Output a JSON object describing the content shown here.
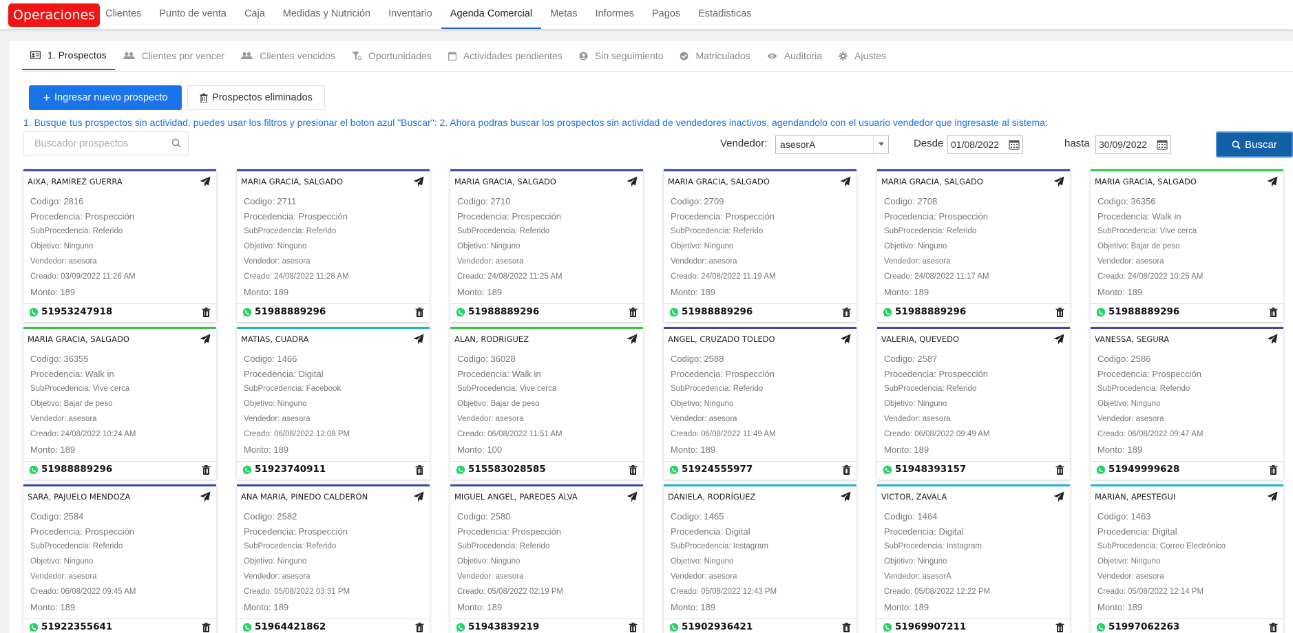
{
  "brand": "Operaciones",
  "topnav": [
    "Clientes",
    "Punto de venta",
    "Caja",
    "Medidas y Nutrición",
    "Inventario",
    "Agenda Comercial",
    "Metas",
    "Informes",
    "Pagos",
    "Estadisticas"
  ],
  "topnav_active": "Agenda Comercial",
  "tabs": [
    {
      "label": "1. Prospectos",
      "icon": "id-card-icon",
      "active": true
    },
    {
      "label": "Clientes por vencer",
      "icon": "users-icon"
    },
    {
      "label": "Clientes vencidos",
      "icon": "users-icon"
    },
    {
      "label": "Oportunidades",
      "icon": "filter-icon"
    },
    {
      "label": "Actividades pendientes",
      "icon": "calendar-icon"
    },
    {
      "label": "Sin seguimiento",
      "icon": "user-circle-icon"
    },
    {
      "label": "Matriculados",
      "icon": "check-circle-icon"
    },
    {
      "label": "Auditoria",
      "icon": "eye-icon"
    },
    {
      "label": "Ajustes",
      "icon": "gear-icon"
    }
  ],
  "actions": {
    "new_prospect": "Ingresar nuevo prospecto",
    "deleted_prospects": "Prospectos eliminados"
  },
  "help_text": "1. Busque tus prospectos sin actividad, puedes usar los filtros y presionar el boton azul \"Buscar\": 2. Ahora podras buscar los prospectos sin actividad de vendedores inactivos, agendandolo con el usuario vendedor que ingresaste al sistema:",
  "filters": {
    "search_placeholder": "Buscador prospectos",
    "vendedor_label": "Vendedor:",
    "vendedor_value": "asesorA",
    "desde_label": "Desde",
    "desde_value": "01/08/2022",
    "hasta_label": "hasta",
    "hasta_value": "30/09/2022",
    "buscar_label": "Buscar"
  },
  "colors": {
    "brand": "#f01414",
    "primary": "#1a73e8",
    "buscar": "#1460a6",
    "card_blue": "#3a4aa8",
    "card_green": "#2ecc40",
    "card_cyan": "#1ab5d0",
    "whatsapp": "#25d366"
  },
  "prospects": [
    {
      "name": "AIXA, RAMÍREZ GUERRA",
      "codigo": "Codigo: 2816",
      "procedencia": "Procedencia: Prospección",
      "subprocedencia": "SubProcedencia: Referido",
      "objetivo": "Objetivo: Ninguno",
      "vendedor": "Vendedor: asesora",
      "creado": "Creado: 03/09/2022 11:26 AM",
      "monto": "Monto: 189",
      "phone": "51953247918",
      "accent": "blue"
    },
    {
      "name": "MARIA GRACIA, SALGADO",
      "codigo": "Codigo: 2711",
      "procedencia": "Procedencia: Prospección",
      "subprocedencia": "SubProcedencia: Referido",
      "objetivo": "Objetivo: Ninguno",
      "vendedor": "Vendedor: asesora",
      "creado": "Creado: 24/08/2022 11:28 AM",
      "monto": "Monto: 189",
      "phone": "51988889296",
      "accent": "blue"
    },
    {
      "name": "MARIA GRACIA, SALGADO",
      "codigo": "Codigo: 2710",
      "procedencia": "Procedencia: Prospección",
      "subprocedencia": "SubProcedencia: Referido",
      "objetivo": "Objetivo: Ninguno",
      "vendedor": "Vendedor: asesora",
      "creado": "Creado: 24/08/2022 11:25 AM",
      "monto": "Monto: 189",
      "phone": "51988889296",
      "accent": "blue"
    },
    {
      "name": "MARIA GRACIA, SALGADO",
      "codigo": "Codigo: 2709",
      "procedencia": "Procedencia: Prospección",
      "subprocedencia": "SubProcedencia: Referido",
      "objetivo": "Objetivo: Ninguno",
      "vendedor": "Vendedor: asesora",
      "creado": "Creado: 24/08/2022 11:19 AM",
      "monto": "Monto: 189",
      "phone": "51988889296",
      "accent": "blue"
    },
    {
      "name": "MARIA GRACIA, SALGADO",
      "codigo": "Codigo: 2708",
      "procedencia": "Procedencia: Prospección",
      "subprocedencia": "SubProcedencia: Referido",
      "objetivo": "Objetivo: Ninguno",
      "vendedor": "Vendedor: asesora",
      "creado": "Creado: 24/08/2022 11:17 AM",
      "monto": "Monto: 189",
      "phone": "51988889296",
      "accent": "blue"
    },
    {
      "name": "MARIA GRACIA, SALGADO",
      "codigo": "Codigo: 36356",
      "procedencia": "Procedencia: Walk in",
      "subprocedencia": "SubProcedencia: Vive cerca",
      "objetivo": "Objetivo: Bajar de peso",
      "vendedor": "Vendedor: asesora",
      "creado": "Creado: 24/08/2022 10:25 AM",
      "monto": "Monto: 189",
      "phone": "51988889296",
      "accent": "green"
    },
    {
      "name": "MARIA GRACIA, SALGADO",
      "codigo": "Codigo: 36355",
      "procedencia": "Procedencia: Walk in",
      "subprocedencia": "SubProcedencia: Vive cerca",
      "objetivo": "Objetivo: Bajar de peso",
      "vendedor": "Vendedor: asesora",
      "creado": "Creado: 24/08/2022 10:24 AM",
      "monto": "Monto: 189",
      "phone": "51988889296",
      "accent": "green"
    },
    {
      "name": "MATIAS, CUADRA",
      "codigo": "Codigo: 1466",
      "procedencia": "Procedencia: Digital",
      "subprocedencia": "SubProcedencia: Facebook",
      "objetivo": "Objetivo: Ninguno",
      "vendedor": "Vendedor: asesora",
      "creado": "Creado: 06/08/2022 12:08 PM",
      "monto": "Monto: 189",
      "phone": "51923740911",
      "accent": "cyan"
    },
    {
      "name": "ALAN, RODRIGUEZ",
      "codigo": "Codigo: 36028",
      "procedencia": "Procedencia: Walk in",
      "subprocedencia": "SubProcedencia: Vive cerca",
      "objetivo": "Objetivo: Bajar de peso",
      "vendedor": "Vendedor: asesora",
      "creado": "Creado: 06/08/2022 11:51 AM",
      "monto": "Monto: 100",
      "phone": "515583028585",
      "accent": "green"
    },
    {
      "name": "ANGEL, CRUZADO TOLEDO",
      "codigo": "Codigo: 2588",
      "procedencia": "Procedencia: Prospección",
      "subprocedencia": "SubProcedencia: Referido",
      "objetivo": "Objetivo: Ninguno",
      "vendedor": "Vendedor: asesora",
      "creado": "Creado: 06/08/2022 11:49 AM",
      "monto": "Monto: 189",
      "phone": "51924555977",
      "accent": "blue"
    },
    {
      "name": "VALERIA, QUEVEDO",
      "codigo": "Codigo: 2587",
      "procedencia": "Procedencia: Prospección",
      "subprocedencia": "SubProcedencia: Referido",
      "objetivo": "Objetivo: Ninguno",
      "vendedor": "Vendedor: asesora",
      "creado": "Creado: 06/08/2022 09:49 AM",
      "monto": "Monto: 189",
      "phone": "51948393157",
      "accent": "blue"
    },
    {
      "name": "VANESSA, SEGURA",
      "codigo": "Codigo: 2586",
      "procedencia": "Procedencia: Prospección",
      "subprocedencia": "SubProcedencia: Referido",
      "objetivo": "Objetivo: Ninguno",
      "vendedor": "Vendedor: asesora",
      "creado": "Creado: 06/08/2022 09:47 AM",
      "monto": "Monto: 189",
      "phone": "51949999628",
      "accent": "blue"
    },
    {
      "name": "SARA, PAJUELO MENDOZA",
      "codigo": "Codigo: 2584",
      "procedencia": "Procedencia: Prospección",
      "subprocedencia": "SubProcedencia: Referido",
      "objetivo": "Objetivo: Ninguno",
      "vendedor": "Vendedor: asesora",
      "creado": "Creado: 06/08/2022 09:45 AM",
      "monto": "Monto: 189",
      "phone": "51922355641",
      "accent": "blue"
    },
    {
      "name": "ANA MARIA, PINEDO CALDERÓN",
      "codigo": "Codigo: 2582",
      "procedencia": "Procedencia: Prospección",
      "subprocedencia": "SubProcedencia: Referido",
      "objetivo": "Objetivo: Ninguno",
      "vendedor": "Vendedor: asesora",
      "creado": "Creado: 05/08/2022 03:31 PM",
      "monto": "Monto: 189",
      "phone": "51964421862",
      "accent": "blue"
    },
    {
      "name": "MIGUEL ANGEL, PAREDES ALVA",
      "codigo": "Codigo: 2580",
      "procedencia": "Procedencia: Prospección",
      "subprocedencia": "SubProcedencia: Referido",
      "objetivo": "Objetivo: Ninguno",
      "vendedor": "Vendedor: asesora",
      "creado": "Creado: 05/08/2022 02:19 PM",
      "monto": "Monto: 189",
      "phone": "51943839219",
      "accent": "blue"
    },
    {
      "name": "DANIELA, RODRÍGUEZ",
      "codigo": "Codigo: 1465",
      "procedencia": "Procedencia: Digital",
      "subprocedencia": "SubProcedencia: Instagram",
      "objetivo": "Objetivo: Ninguno",
      "vendedor": "Vendedor: asesora",
      "creado": "Creado: 05/08/2022 12:43 PM",
      "monto": "Monto: 189",
      "phone": "51902936421",
      "accent": "cyan"
    },
    {
      "name": "VICTOR, ZAVALA",
      "codigo": "Codigo: 1464",
      "procedencia": "Procedencia: Digital",
      "subprocedencia": "SubProcedencia: Instagram",
      "objetivo": "Objetivo: Ninguno",
      "vendedor": "Vendedor: asesorA",
      "creado": "Creado: 05/08/2022 12:22 PM",
      "monto": "Monto: 189",
      "phone": "51969907211",
      "accent": "cyan"
    },
    {
      "name": "MARIAN, APESTEGUI",
      "codigo": "Codigo: 1463",
      "procedencia": "Procedencia: Digital",
      "subprocedencia": "SubProcedencia: Correo Electrónico",
      "objetivo": "Objetivo: Ninguno",
      "vendedor": "Vendedor: asesora",
      "creado": "Creado: 05/08/2022 12:14 PM",
      "monto": "Monto: 189",
      "phone": "51997062263",
      "accent": "cyan"
    }
  ]
}
